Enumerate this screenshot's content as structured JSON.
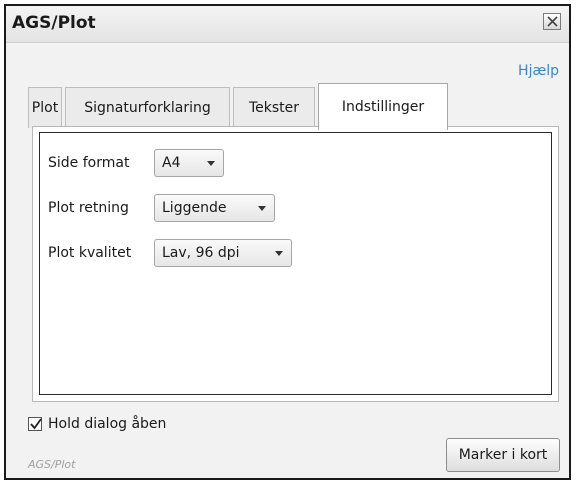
{
  "window": {
    "title": "AGS/Plot"
  },
  "help": {
    "label": "Hjælp"
  },
  "tabs": [
    {
      "label": "Plot",
      "active": false
    },
    {
      "label": "Signaturforklaring",
      "active": false
    },
    {
      "label": "Tekster",
      "active": false
    },
    {
      "label": "Indstillinger",
      "active": true
    }
  ],
  "settings": {
    "page_format": {
      "label": "Side format",
      "value": "A4"
    },
    "plot_direction": {
      "label": "Plot retning",
      "value": "Liggende"
    },
    "plot_quality": {
      "label": "Plot kvalitet",
      "value": "Lav, 96 dpi"
    }
  },
  "footer": {
    "keep_open": {
      "label": "Hold dialog åben",
      "checked": true
    },
    "app_name": "AGS/Plot",
    "mark_button_label": "Marker i kort"
  },
  "colors": {
    "link": "#3a86c8",
    "background": "#f2f2f2"
  }
}
